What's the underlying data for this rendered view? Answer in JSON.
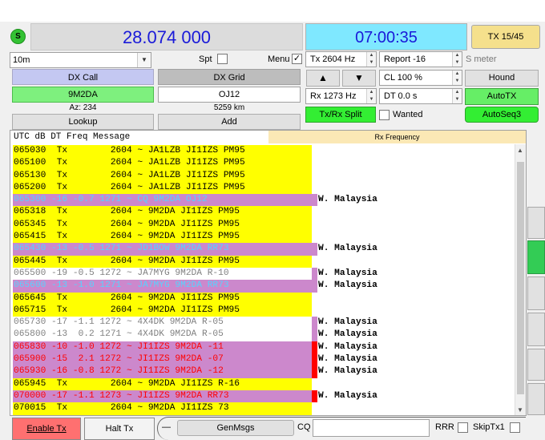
{
  "header": {
    "s_badge": "S",
    "frequency": "28.074 000",
    "time": "07:00:35",
    "tx_counter": "TX 15/45"
  },
  "controls": {
    "band": "10m",
    "spt_label": "Spt",
    "menu_label": "Menu",
    "menu_checked": "✓",
    "tx_freq": "Tx  2604  Hz",
    "report": "Report -16",
    "s_meter": "S meter",
    "cl": "CL  100 %",
    "hound": "Hound",
    "rx_freq": "Rx  1273  Hz",
    "dt": "DT 0.0 s",
    "autotx": "AutoTX",
    "txrx_split": "Tx/Rx Split",
    "wanted": "Wanted",
    "autoseq": "AutoSeq3",
    "up_arrow": "▲",
    "down_arrow": "▼"
  },
  "dx": {
    "call_label": "DX Call",
    "grid_label": "DX Grid",
    "call": "9M2DA",
    "grid": "OJ12",
    "az": "Az: 234",
    "distance": "5259 km",
    "lookup": "Lookup",
    "add": "Add"
  },
  "log_header": {
    "left": "UTC     dB   DT Freq   Message",
    "right": "Rx Frequency"
  },
  "colors": {
    "tx_bg": "#ffff00",
    "cq_bg": "#cc88cc",
    "cq_fg": "#55d4ff",
    "mine_bg": "#cc88cc",
    "mine_fg": "#ff0000",
    "normal_fg": "#808080",
    "enable_tx": "#ff7070",
    "green": "#66ee66"
  },
  "rows": [
    {
      "text": "065030  Tx        2604 ~ JA1LZB JI1IZS PM95",
      "style": "tx",
      "country": ""
    },
    {
      "text": "065100  Tx        2604 ~ JA1LZB JI1IZS PM95",
      "style": "tx",
      "country": ""
    },
    {
      "text": "065130  Tx        2604 ~ JA1LZB JI1IZS PM95",
      "style": "tx",
      "country": ""
    },
    {
      "text": "065200  Tx        2604 ~ JA1LZB JI1IZS PM95",
      "style": "tx",
      "country": ""
    },
    {
      "text": "065300 -16 -0.7 1271 ~ CQ 9M2DA OJ12",
      "style": "cq",
      "country": "W. Malaysia"
    },
    {
      "text": "065318  Tx        2604 ~ 9M2DA JI1IZS PM95",
      "style": "tx",
      "country": ""
    },
    {
      "text": "065345  Tx        2604 ~ 9M2DA JI1IZS PM95",
      "style": "tx",
      "country": ""
    },
    {
      "text": "065415  Tx        2604 ~ 9M2DA JI1IZS PM95",
      "style": "tx",
      "country": ""
    },
    {
      "text": "065430 -13 -0.5 1271 ~ JD1BOW 9M2DA RR73",
      "style": "cq",
      "country": "W. Malaysia"
    },
    {
      "text": "065445  Tx        2604 ~ 9M2DA JI1IZS PM95",
      "style": "tx",
      "country": ""
    },
    {
      "text": "065500 -19 -0.5 1272 ~ JA7MYG 9M2DA R-10",
      "style": "normal",
      "country": "W. Malaysia"
    },
    {
      "text": "065600 -13 -1.0 1271 ~ JA7MYG 9M2DA RR73",
      "style": "cq",
      "country": "W. Malaysia"
    },
    {
      "text": "065645  Tx        2604 ~ 9M2DA JI1IZS PM95",
      "style": "tx",
      "country": ""
    },
    {
      "text": "065715  Tx        2604 ~ 9M2DA JI1IZS PM95",
      "style": "tx",
      "country": ""
    },
    {
      "text": "065730 -17 -1.1 1272 ~ 4X4DK 9M2DA R-05",
      "style": "normal",
      "country": "W. Malaysia"
    },
    {
      "text": "065800 -13  0.2 1271 ~ 4X4DK 9M2DA R-05",
      "style": "normal",
      "country": "W. Malaysia"
    },
    {
      "text": "065830 -10 -1.0 1272 ~ JI1IZS 9M2DA -11",
      "style": "mine",
      "country": "W. Malaysia"
    },
    {
      "text": "065900 -15  2.1 1272 ~ JI1IZS 9M2DA -07",
      "style": "mine",
      "country": "W. Malaysia"
    },
    {
      "text": "065930 -16 -0.8 1272 ~ JI1IZS 9M2DA -12",
      "style": "mine",
      "country": "W. Malaysia"
    },
    {
      "text": "065945  Tx        2604 ~ 9M2DA JI1IZS R-16",
      "style": "tx",
      "country": ""
    },
    {
      "text": "070000 -17 -1.1 1273 ~ JI1IZS 9M2DA RR73",
      "style": "mine",
      "country": "W. Malaysia"
    },
    {
      "text": "070015  Tx        2604 ~ 9M2DA JI1IZS 73",
      "style": "tx",
      "country": ""
    }
  ],
  "bottom": {
    "enable_tx": "Enable Tx",
    "halt_tx": "Halt Tx",
    "dash": "—",
    "genmsgs": "GenMsgs",
    "cq": "CQ",
    "rrr": "RRR",
    "skiptx1": "SkipTx1"
  }
}
